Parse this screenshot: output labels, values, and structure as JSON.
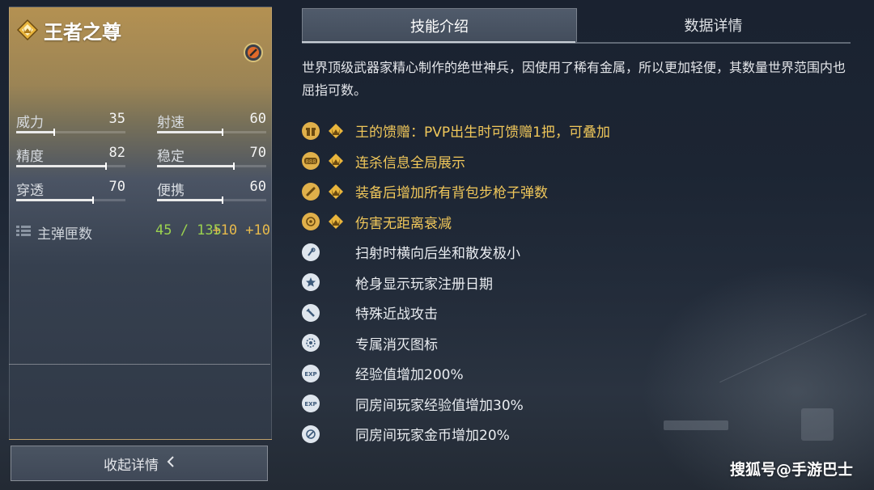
{
  "weapon": {
    "name": "王者之尊",
    "stats": [
      {
        "label": "威力",
        "value": "35",
        "fraction": 0.35
      },
      {
        "label": "射速",
        "value": "60",
        "fraction": 0.6
      },
      {
        "label": "精度",
        "value": "82",
        "fraction": 0.82
      },
      {
        "label": "稳定",
        "value": "70",
        "fraction": 0.7
      },
      {
        "label": "穿透",
        "value": "70",
        "fraction": 0.7
      },
      {
        "label": "便携",
        "value": "60",
        "fraction": 0.6
      }
    ],
    "ammo": {
      "label": "主弹匣数",
      "value": "45 / 135",
      "bonus": "+10 +10"
    }
  },
  "collapse_button": {
    "label": "收起详情"
  },
  "tabs": [
    {
      "label": "技能介绍",
      "active": true
    },
    {
      "label": "数据详情",
      "active": false
    }
  ],
  "description": "世界顶级武器家精心制作的绝世神兵，因使用了稀有金属，所以更加轻便，其数量世界范围内也屈指可数。",
  "features": [
    {
      "text": "王的馈赠：PVP出生时可馈赠1把，可叠加",
      "icon": "gift-icon",
      "vip": true,
      "color": "#f0c75a"
    },
    {
      "text": "连杀信息全局展示",
      "icon": "killstreak-icon",
      "vip": true,
      "color": "#f0c75a"
    },
    {
      "text": "装备后增加所有背包步枪子弹数",
      "icon": "bullet-icon",
      "vip": true,
      "color": "#f0c75a"
    },
    {
      "text": "伤害无距离衰减",
      "icon": "target-icon",
      "vip": true,
      "color": "#f0c75a"
    },
    {
      "text": "扫射时横向后坐和散发极小",
      "icon": "recoil-icon",
      "vip": false,
      "color": "#e9ecf0"
    },
    {
      "text": "枪身显示玩家注册日期",
      "icon": "star-icon",
      "vip": false,
      "color": "#e9ecf0"
    },
    {
      "text": "特殊近战攻击",
      "icon": "knife-icon",
      "vip": false,
      "color": "#e9ecf0"
    },
    {
      "text": "专属消灭图标",
      "icon": "elimination-icon",
      "vip": false,
      "color": "#e9ecf0"
    },
    {
      "text": "经验值增加200%",
      "icon": "exp-icon",
      "vip": false,
      "color": "#e9ecf0"
    },
    {
      "text": "同房间玩家经验值增加30%",
      "icon": "exp-room-icon",
      "vip": false,
      "color": "#e9ecf0"
    },
    {
      "text": "同房间玩家金币增加20%",
      "icon": "coin-icon",
      "vip": false,
      "color": "#e9ecf0"
    }
  ],
  "watermark": "搜狐号@手游巴士",
  "colors": {
    "gold": "#f0c75a",
    "ammo_green": "#9bd14f",
    "bonus_orange": "#e6b94c"
  }
}
